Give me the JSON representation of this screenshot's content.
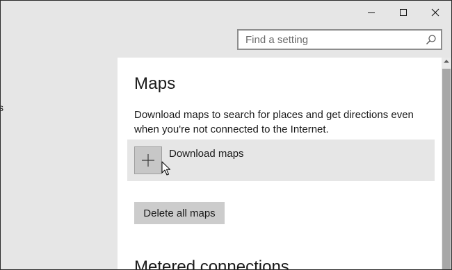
{
  "window": {
    "controls": [
      {
        "name": "minimize-button",
        "icon": "minimize-icon"
      },
      {
        "name": "maximize-button",
        "icon": "maximize-icon"
      },
      {
        "name": "close-button",
        "icon": "close-icon"
      }
    ]
  },
  "search": {
    "placeholder": "Find a setting",
    "value": "",
    "icon": "search-icon"
  },
  "sidebar": {
    "partial_item_text": "s"
  },
  "main": {
    "title": "Maps",
    "description": "Download maps to search for places and get directions even when you're not connected to the Internet.",
    "download_row": {
      "icon": "plus-icon",
      "label": "Download maps"
    },
    "delete_button_label": "Delete all maps",
    "next_section_heading": "Metered connections"
  },
  "colors": {
    "chrome_background": "#e6e6e6",
    "content_background": "#ffffff",
    "button_background": "#cccccc",
    "scroll_thumb": "#a7a7a7",
    "text": "#1a1a1a"
  }
}
